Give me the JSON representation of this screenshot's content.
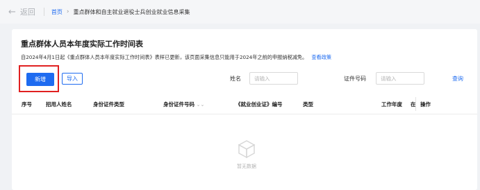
{
  "nav": {
    "back_label": "返回",
    "breadcrumb": {
      "home": "首页",
      "separator": "›",
      "current": "重点群体和自主就业退役士兵创业就业信息采集"
    }
  },
  "card": {
    "title": "重点群体人员本年度实际工作时间表",
    "notice_text": "自2024年4月1日起《重点群体人员本年度实际工作时间表》表样已更新，该页面采集信息只能用于2024年之前的申报纳税减免。",
    "notice_link": "查看政策"
  },
  "toolbar": {
    "add_label": "新增",
    "import_label": "导入"
  },
  "filters": {
    "name_label": "姓名",
    "name_placeholder": "请输入",
    "id_label": "证件号码",
    "id_placeholder": "请输入",
    "search_label": "查询"
  },
  "table": {
    "headers": [
      "序号",
      "招用人姓名",
      "身份证件类型",
      "身份证件号码",
      "《就业创业证》编号",
      "类型",
      "工作年度",
      "在",
      "操作"
    ],
    "sort_glyph": "⌄⌄"
  },
  "empty": {
    "text": "暂无数据"
  },
  "colors": {
    "accent": "#1e6bf0",
    "highlight": "#e02020"
  },
  "icons": {
    "back": "arrow-left-icon",
    "empty": "empty-box-icon"
  }
}
